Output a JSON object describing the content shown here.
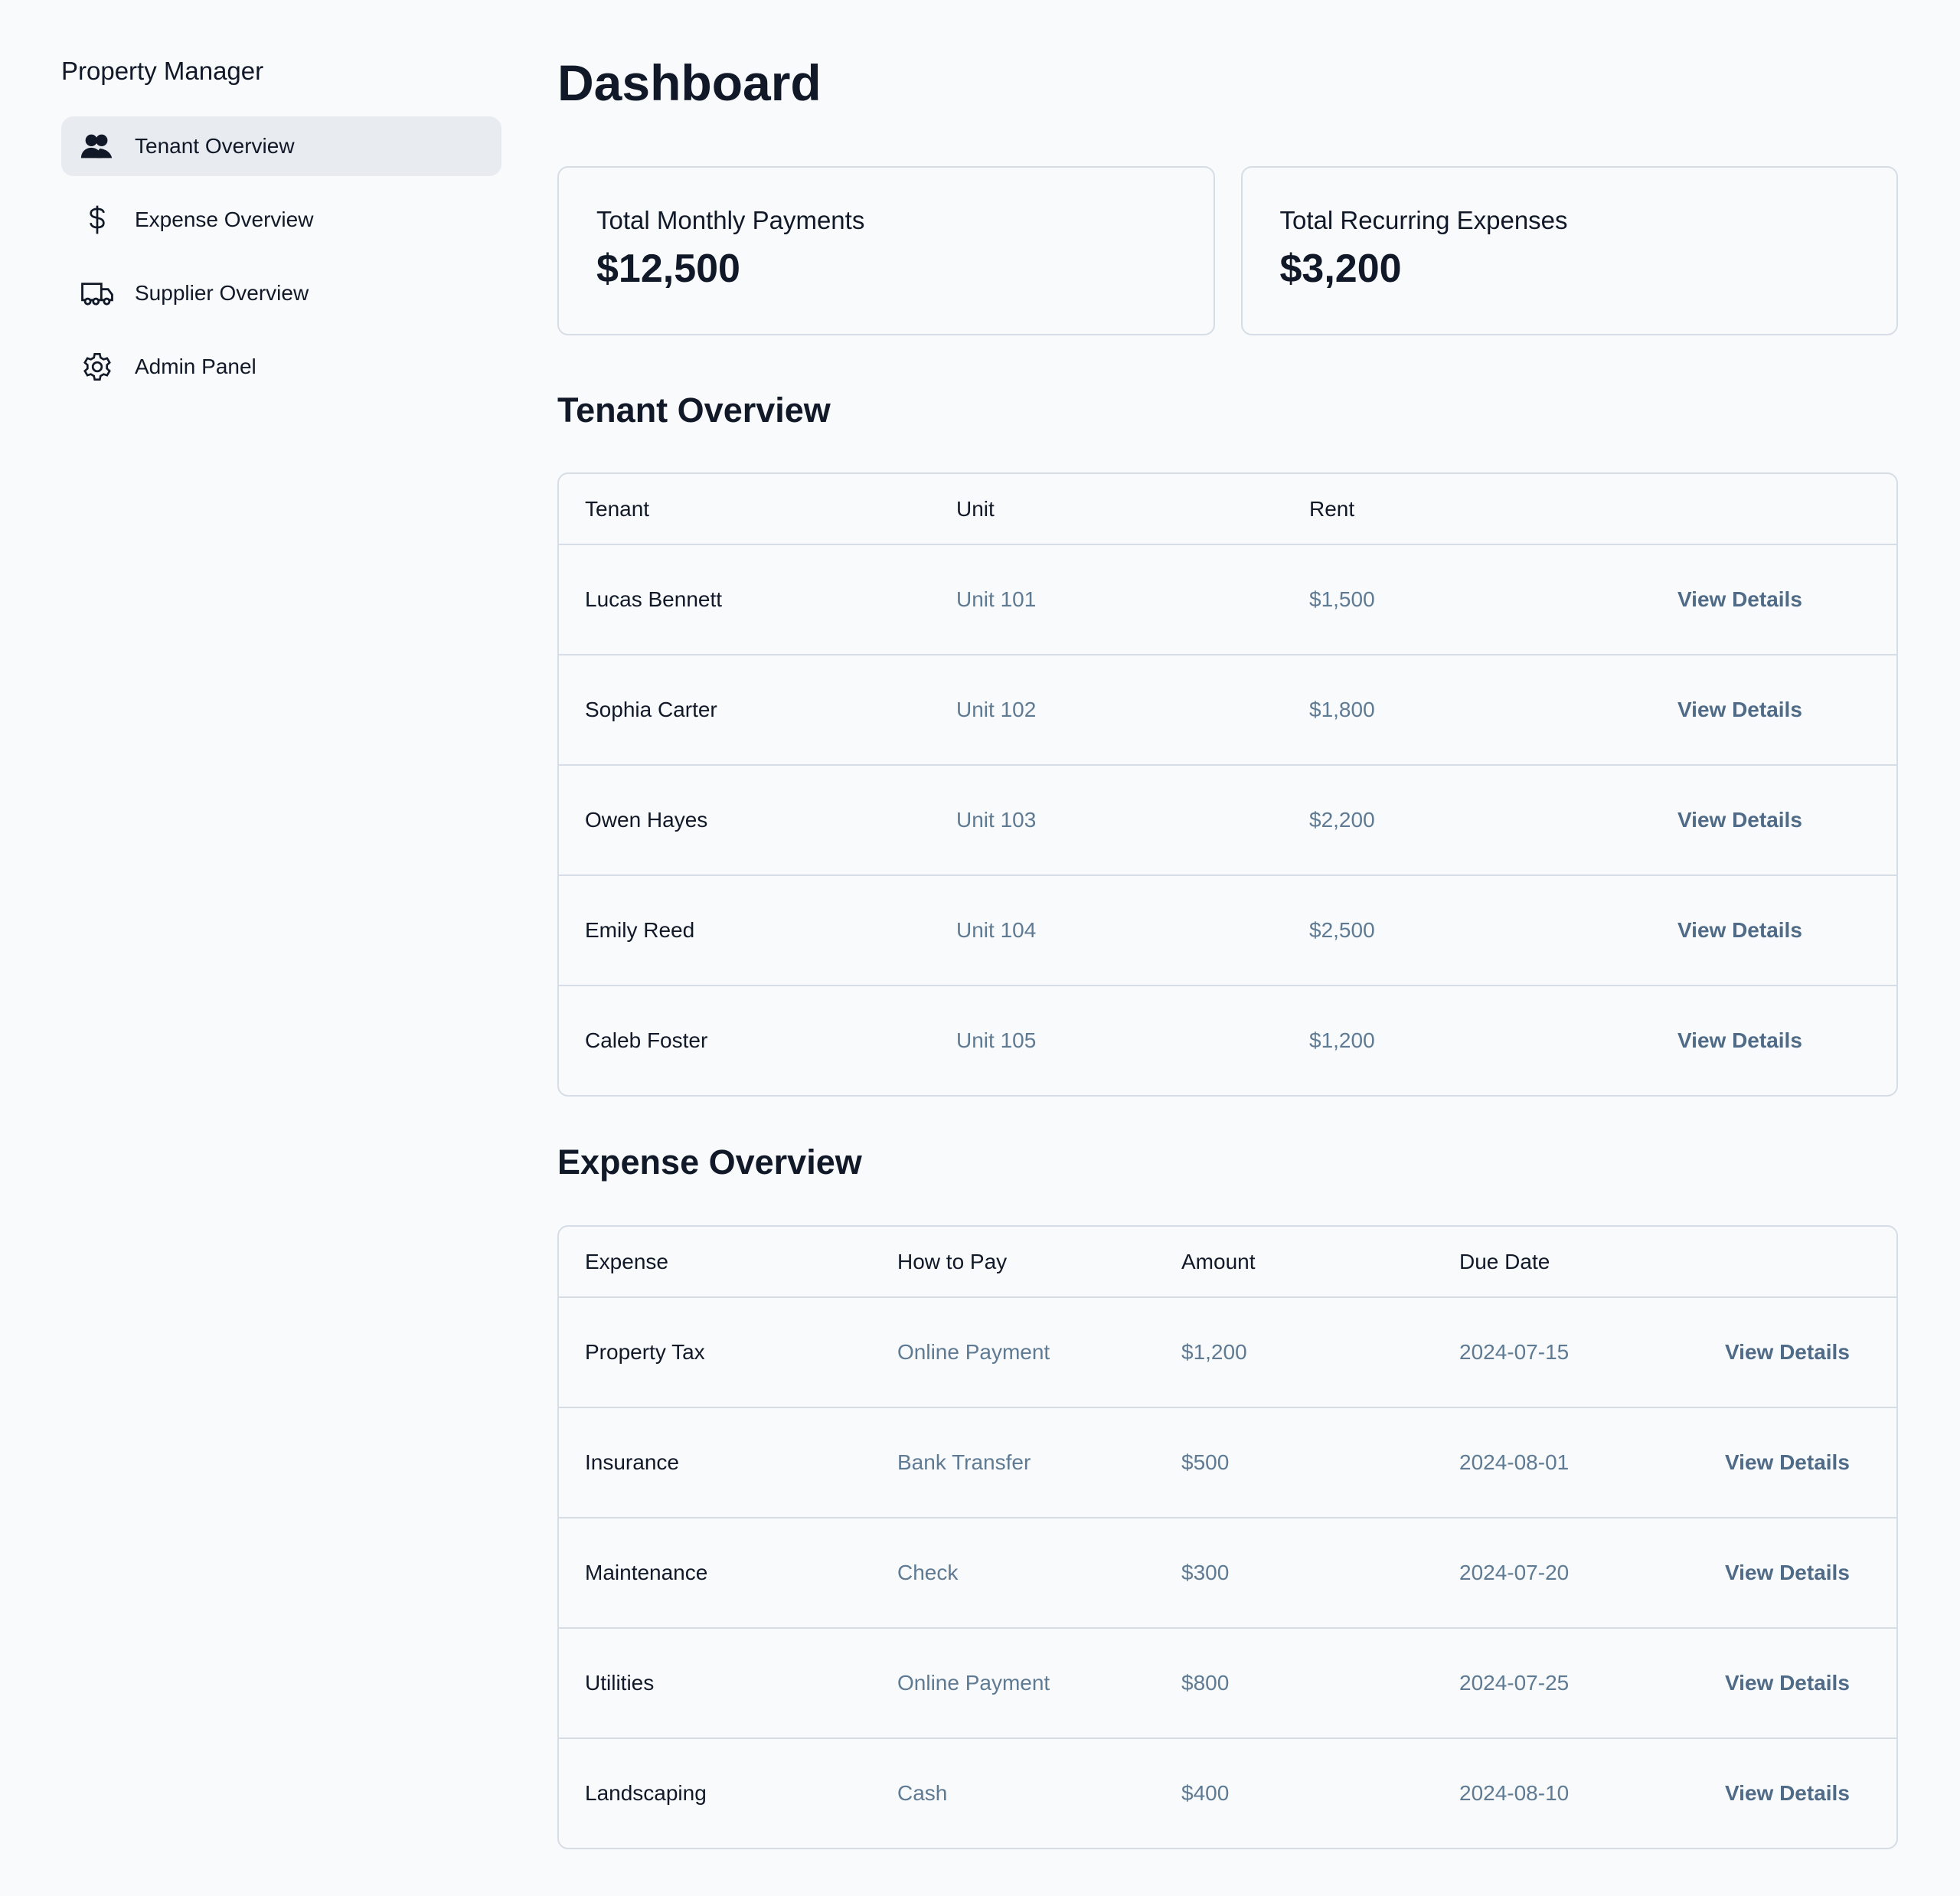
{
  "sidebar": {
    "title": "Property Manager",
    "items": [
      {
        "label": "Tenant Overview",
        "icon": "users-icon",
        "active": true
      },
      {
        "label": "Expense Overview",
        "icon": "dollar-icon"
      },
      {
        "label": "Supplier Overview",
        "icon": "truck-icon"
      },
      {
        "label": "Admin Panel",
        "icon": "gear-icon"
      }
    ]
  },
  "header": {
    "title": "Dashboard"
  },
  "cards": [
    {
      "label": "Total Monthly Payments",
      "value": "$12,500"
    },
    {
      "label": "Total Recurring Expenses",
      "value": "$3,200"
    }
  ],
  "tenants": {
    "title": "Tenant Overview",
    "columns": [
      "Tenant",
      "Unit",
      "Rent"
    ],
    "action": "View Details",
    "rows": [
      {
        "name": "Lucas Bennett",
        "unit": "Unit 101",
        "rent": "$1,500"
      },
      {
        "name": "Sophia Carter",
        "unit": "Unit 102",
        "rent": "$1,800"
      },
      {
        "name": "Owen Hayes",
        "unit": "Unit 103",
        "rent": "$2,200"
      },
      {
        "name": "Emily Reed",
        "unit": "Unit 104",
        "rent": "$2,500"
      },
      {
        "name": "Caleb Foster",
        "unit": "Unit 105",
        "rent": "$1,200"
      }
    ]
  },
  "expenses": {
    "title": "Expense Overview",
    "columns": [
      "Expense",
      "How to Pay",
      "Amount",
      "Due Date"
    ],
    "action": "View Details",
    "rows": [
      {
        "name": "Property Tax",
        "method": "Online Payment",
        "amount": "$1,200",
        "due": "2024-07-15"
      },
      {
        "name": "Insurance",
        "method": "Bank Transfer",
        "amount": "$500",
        "due": "2024-08-01"
      },
      {
        "name": "Maintenance",
        "method": "Check",
        "amount": "$300",
        "due": "2024-07-20"
      },
      {
        "name": "Utilities",
        "method": "Online Payment",
        "amount": "$800",
        "due": "2024-07-25"
      },
      {
        "name": "Landscaping",
        "method": "Cash",
        "amount": "$400",
        "due": "2024-08-10"
      }
    ]
  }
}
